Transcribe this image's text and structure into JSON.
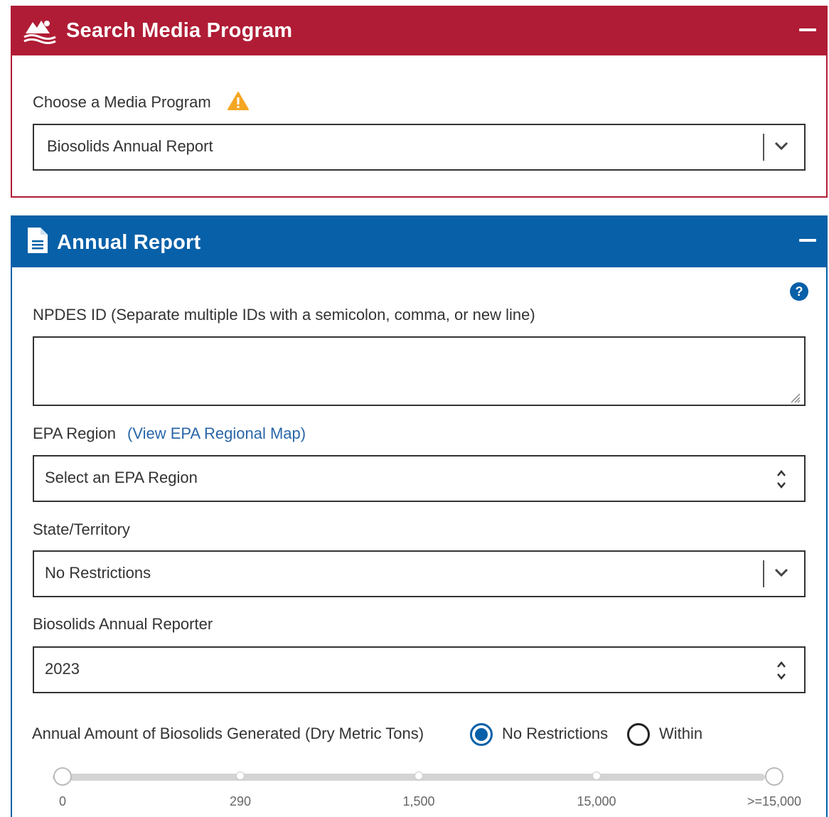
{
  "search_panel": {
    "title": "Search Media Program",
    "icon": "landscape-logo-icon",
    "choose_label": "Choose a Media Program",
    "warning_icon": "warning-icon",
    "selected_program": "Biosolids Annual Report"
  },
  "annual_panel": {
    "title": "Annual Report",
    "icon": "document-icon",
    "help_icon": "help-icon",
    "npdes_label": "NPDES ID (Separate multiple IDs with a semicolon, comma, or new line)",
    "npdes_value": "",
    "epa_region_label": "EPA Region",
    "epa_region_link": "(View EPA Regional Map)",
    "epa_region_value": "Select an EPA Region",
    "state_label": "State/Territory",
    "state_value": "No Restrictions",
    "reporter_label": "Biosolids Annual Reporter",
    "reporter_value": "2023",
    "amount_label": "Annual Amount of Biosolids Generated (Dry Metric Tons)",
    "radio_options": [
      {
        "label": "No Restrictions",
        "selected": true
      },
      {
        "label": "Within",
        "selected": false
      }
    ],
    "slider_ticks": [
      "0",
      "290",
      "1,500",
      "15,000",
      ">=15,000"
    ]
  },
  "colors": {
    "search_header": "#b01c35",
    "annual_header": "#0760a8",
    "link": "#2a66a8",
    "warning": "#f5a623"
  }
}
